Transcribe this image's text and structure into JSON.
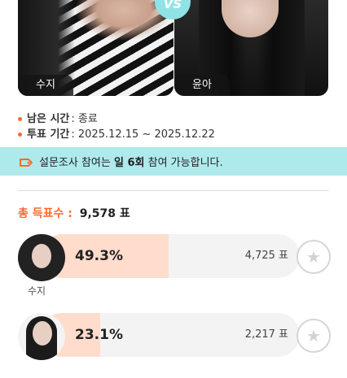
{
  "contest": {
    "left": {
      "name": "수지"
    },
    "right": {
      "name": "윤아"
    },
    "vs_label": "VS"
  },
  "info": {
    "remaining": {
      "label": "남은 시간",
      "value": ": 종료"
    },
    "period": {
      "label": "투표 기간",
      "value": ": 2025.12.15 ~ 2025.12.22"
    }
  },
  "notice": {
    "prefix": "설문조사 참여는 ",
    "highlight": "일 6회",
    "suffix": " 참여 가능합니다."
  },
  "total": {
    "label": "총 득표수 :",
    "count": "9,578 표"
  },
  "candidates": [
    {
      "name": "수지",
      "percent_label": "49.3%",
      "percent": 0.493,
      "votes": "4,725 표"
    },
    {
      "name": "",
      "percent_label": "23.1%",
      "percent": 0.231,
      "votes": "2,217 표"
    }
  ],
  "colors": {
    "accent": "#ff6a2a",
    "notice_bg": "#aeeaec",
    "bar_fill": "#ffdccc",
    "vs": "#8fe3e6"
  },
  "icons": {
    "vote": "star-icon",
    "notice": "ticket-icon"
  }
}
